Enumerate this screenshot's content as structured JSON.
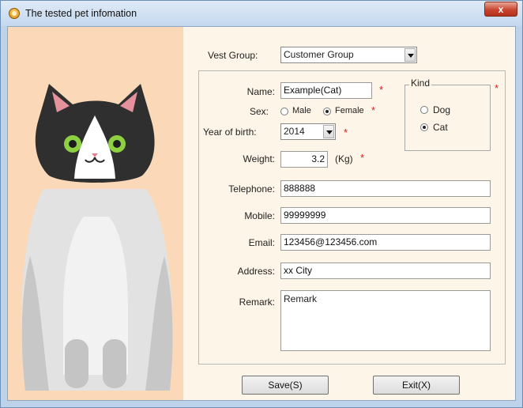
{
  "window": {
    "title": "The tested pet infomation",
    "close_glyph": "x"
  },
  "form": {
    "vest_group": {
      "label": "Vest Group:",
      "value": "Customer Group"
    },
    "name": {
      "label": "Name:",
      "value": "Example(Cat)"
    },
    "sex": {
      "label": "Sex:",
      "options": [
        "Male",
        "Female"
      ],
      "selected": "Female"
    },
    "year": {
      "label": "Year of birth:",
      "value": "2014"
    },
    "weight": {
      "label": "Weight:",
      "value": "3.2",
      "unit": "(Kg)"
    },
    "telephone": {
      "label": "Telephone:",
      "value": "888888"
    },
    "mobile": {
      "label": "Mobile:",
      "value": "99999999"
    },
    "email": {
      "label": "Email:",
      "value": "123456@123456.com"
    },
    "address": {
      "label": "Address:",
      "value": "xx City"
    },
    "remark": {
      "label": "Remark:",
      "value": "Remark"
    },
    "required_mark": "*"
  },
  "kind": {
    "title": "Kind",
    "options": [
      "Dog",
      "Cat"
    ],
    "selected": "Cat"
  },
  "buttons": {
    "save": "Save(S)",
    "exit": "Exit(X)"
  },
  "colors": {
    "required": "#d01f1f",
    "cat_panel_bg": "#fbd9b8",
    "form_bg": "#fdf5e7"
  }
}
